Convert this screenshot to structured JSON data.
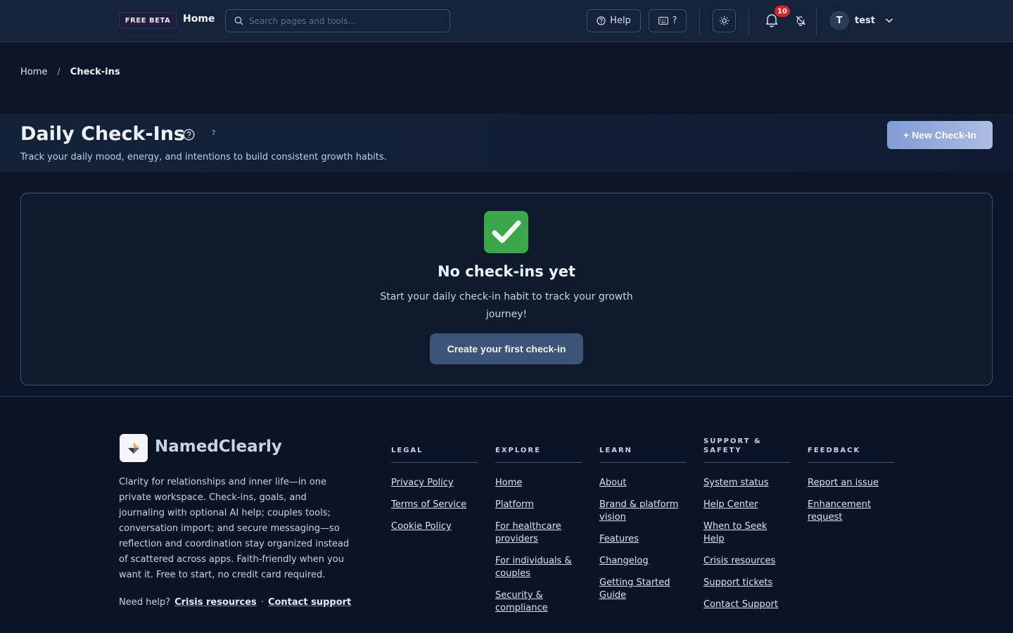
{
  "topbar": {
    "badge": "FREE BETA",
    "home_label": "Home",
    "search_placeholder": "Search pages and tools...",
    "help_label": "Help",
    "shortcut_label": "?",
    "notification_count": "10",
    "user_initial": "T",
    "username": "test"
  },
  "breadcrumb": {
    "home": "Home",
    "separator": "/",
    "current": "Check-ins"
  },
  "header": {
    "title": "Daily Check-Ins",
    "help_hint": "?",
    "subtitle": "Track your daily mood, energy, and intentions to build consistent growth habits.",
    "new_button": "+ New Check-In"
  },
  "empty_state": {
    "icon": "check-mark-emoji",
    "title": "No check-ins yet",
    "text": "Start your daily check-in habit to track your growth journey!",
    "cta": "Create your first check-in"
  },
  "footer": {
    "brand": "NamedClearly",
    "description": "Clarity for relationships and inner life—in one private workspace. Check-ins, goals, and journaling with optional AI help; couples tools; conversation import; and secure messaging—so reflection and coordination stay organized instead of scattered across apps. Faith-friendly when you want it. Free to start, no credit card required.",
    "help_prefix": "Need help?",
    "crisis_link": "Crisis resources",
    "dot": "·",
    "contact_link": "Contact support",
    "columns": [
      {
        "title": "LEGAL",
        "links": [
          "Privacy Policy",
          "Terms of Service",
          "Cookie Policy"
        ]
      },
      {
        "title": "EXPLORE",
        "links": [
          "Home",
          "Platform",
          "For healthcare providers",
          "For individuals & couples",
          "Security & compliance"
        ]
      },
      {
        "title": "LEARN",
        "links": [
          "About",
          "Brand & platform vision",
          "Features",
          "Changelog",
          "Getting Started Guide"
        ]
      },
      {
        "title": "SUPPORT & SAFETY",
        "links": [
          "System status",
          "Help Center",
          "When to Seek Help",
          "Crisis resources",
          "Support tickets",
          "Contact Support"
        ]
      },
      {
        "title": "FEEDBACK",
        "links": [
          "Report an issue",
          "Enhancement request"
        ]
      }
    ]
  },
  "colors": {
    "background": "#0c1628",
    "accent": "#7f9bd6",
    "cta": "#3b5478",
    "notification": "#d0262c",
    "success": "#3aa84a"
  }
}
